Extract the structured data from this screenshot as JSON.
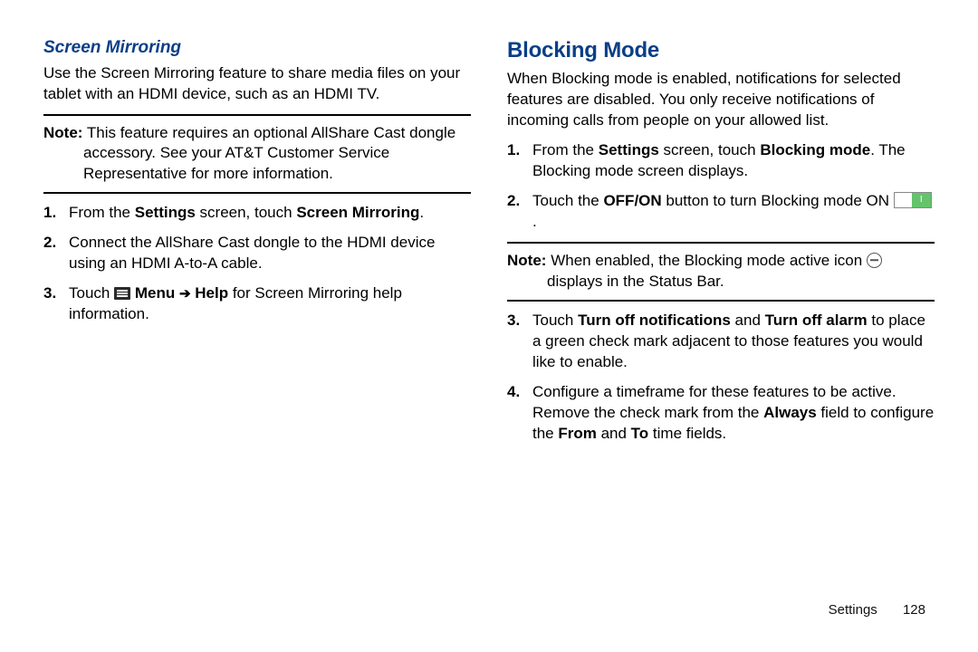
{
  "left": {
    "heading": "Screen Mirroring",
    "intro": "Use the Screen Mirroring feature to share media files on your tablet with an HDMI device, such as an HDMI TV.",
    "note": {
      "label": "Note:",
      "text": "This feature requires an optional AllShare Cast dongle accessory. See your AT&T Customer Service Representative for more information."
    },
    "steps": {
      "s1": {
        "t1": "From the ",
        "b1": "Settings",
        "t2": " screen, touch ",
        "b2": "Screen Mirroring",
        "t3": "."
      },
      "s2": "Connect the AllShare Cast dongle to the HDMI device using an HDMI A-to-A cable.",
      "s3": {
        "t1": "Touch ",
        "b1": "Menu",
        "b2": "Help",
        "t2": " for Screen Mirroring help information."
      }
    }
  },
  "right": {
    "heading": "Blocking Mode",
    "intro": "When Blocking mode is enabled, notifications for selected features are disabled. You only receive notifications of incoming calls from people on your allowed list.",
    "note": {
      "label": "Note:",
      "t1": "When enabled, the Blocking mode active icon ",
      "t2": " displays in the Status Bar."
    },
    "steps": {
      "s1": {
        "t1": "From the ",
        "b1": "Settings",
        "t2": " screen, touch ",
        "b2": "Blocking mode",
        "t3": ". The Blocking mode screen displays."
      },
      "s2": {
        "t1": "Touch the ",
        "b1": "OFF/ON",
        "t2": " button to turn Blocking mode ON ",
        "t3": "."
      },
      "s3": {
        "t1": "Touch ",
        "b1": "Turn off notifications",
        "t2": " and ",
        "b2": "Turn off alarm",
        "t3": " to place a green check mark adjacent to those features you would like to enable."
      },
      "s4": {
        "t1": "Configure a timeframe for these features to be active. Remove the check mark from the ",
        "b1": "Always",
        "t2": " field to configure the ",
        "b2": "From",
        "t3": " and ",
        "b3": "To",
        "t4": " time fields."
      }
    }
  },
  "footer": {
    "section": "Settings",
    "page": "128"
  }
}
